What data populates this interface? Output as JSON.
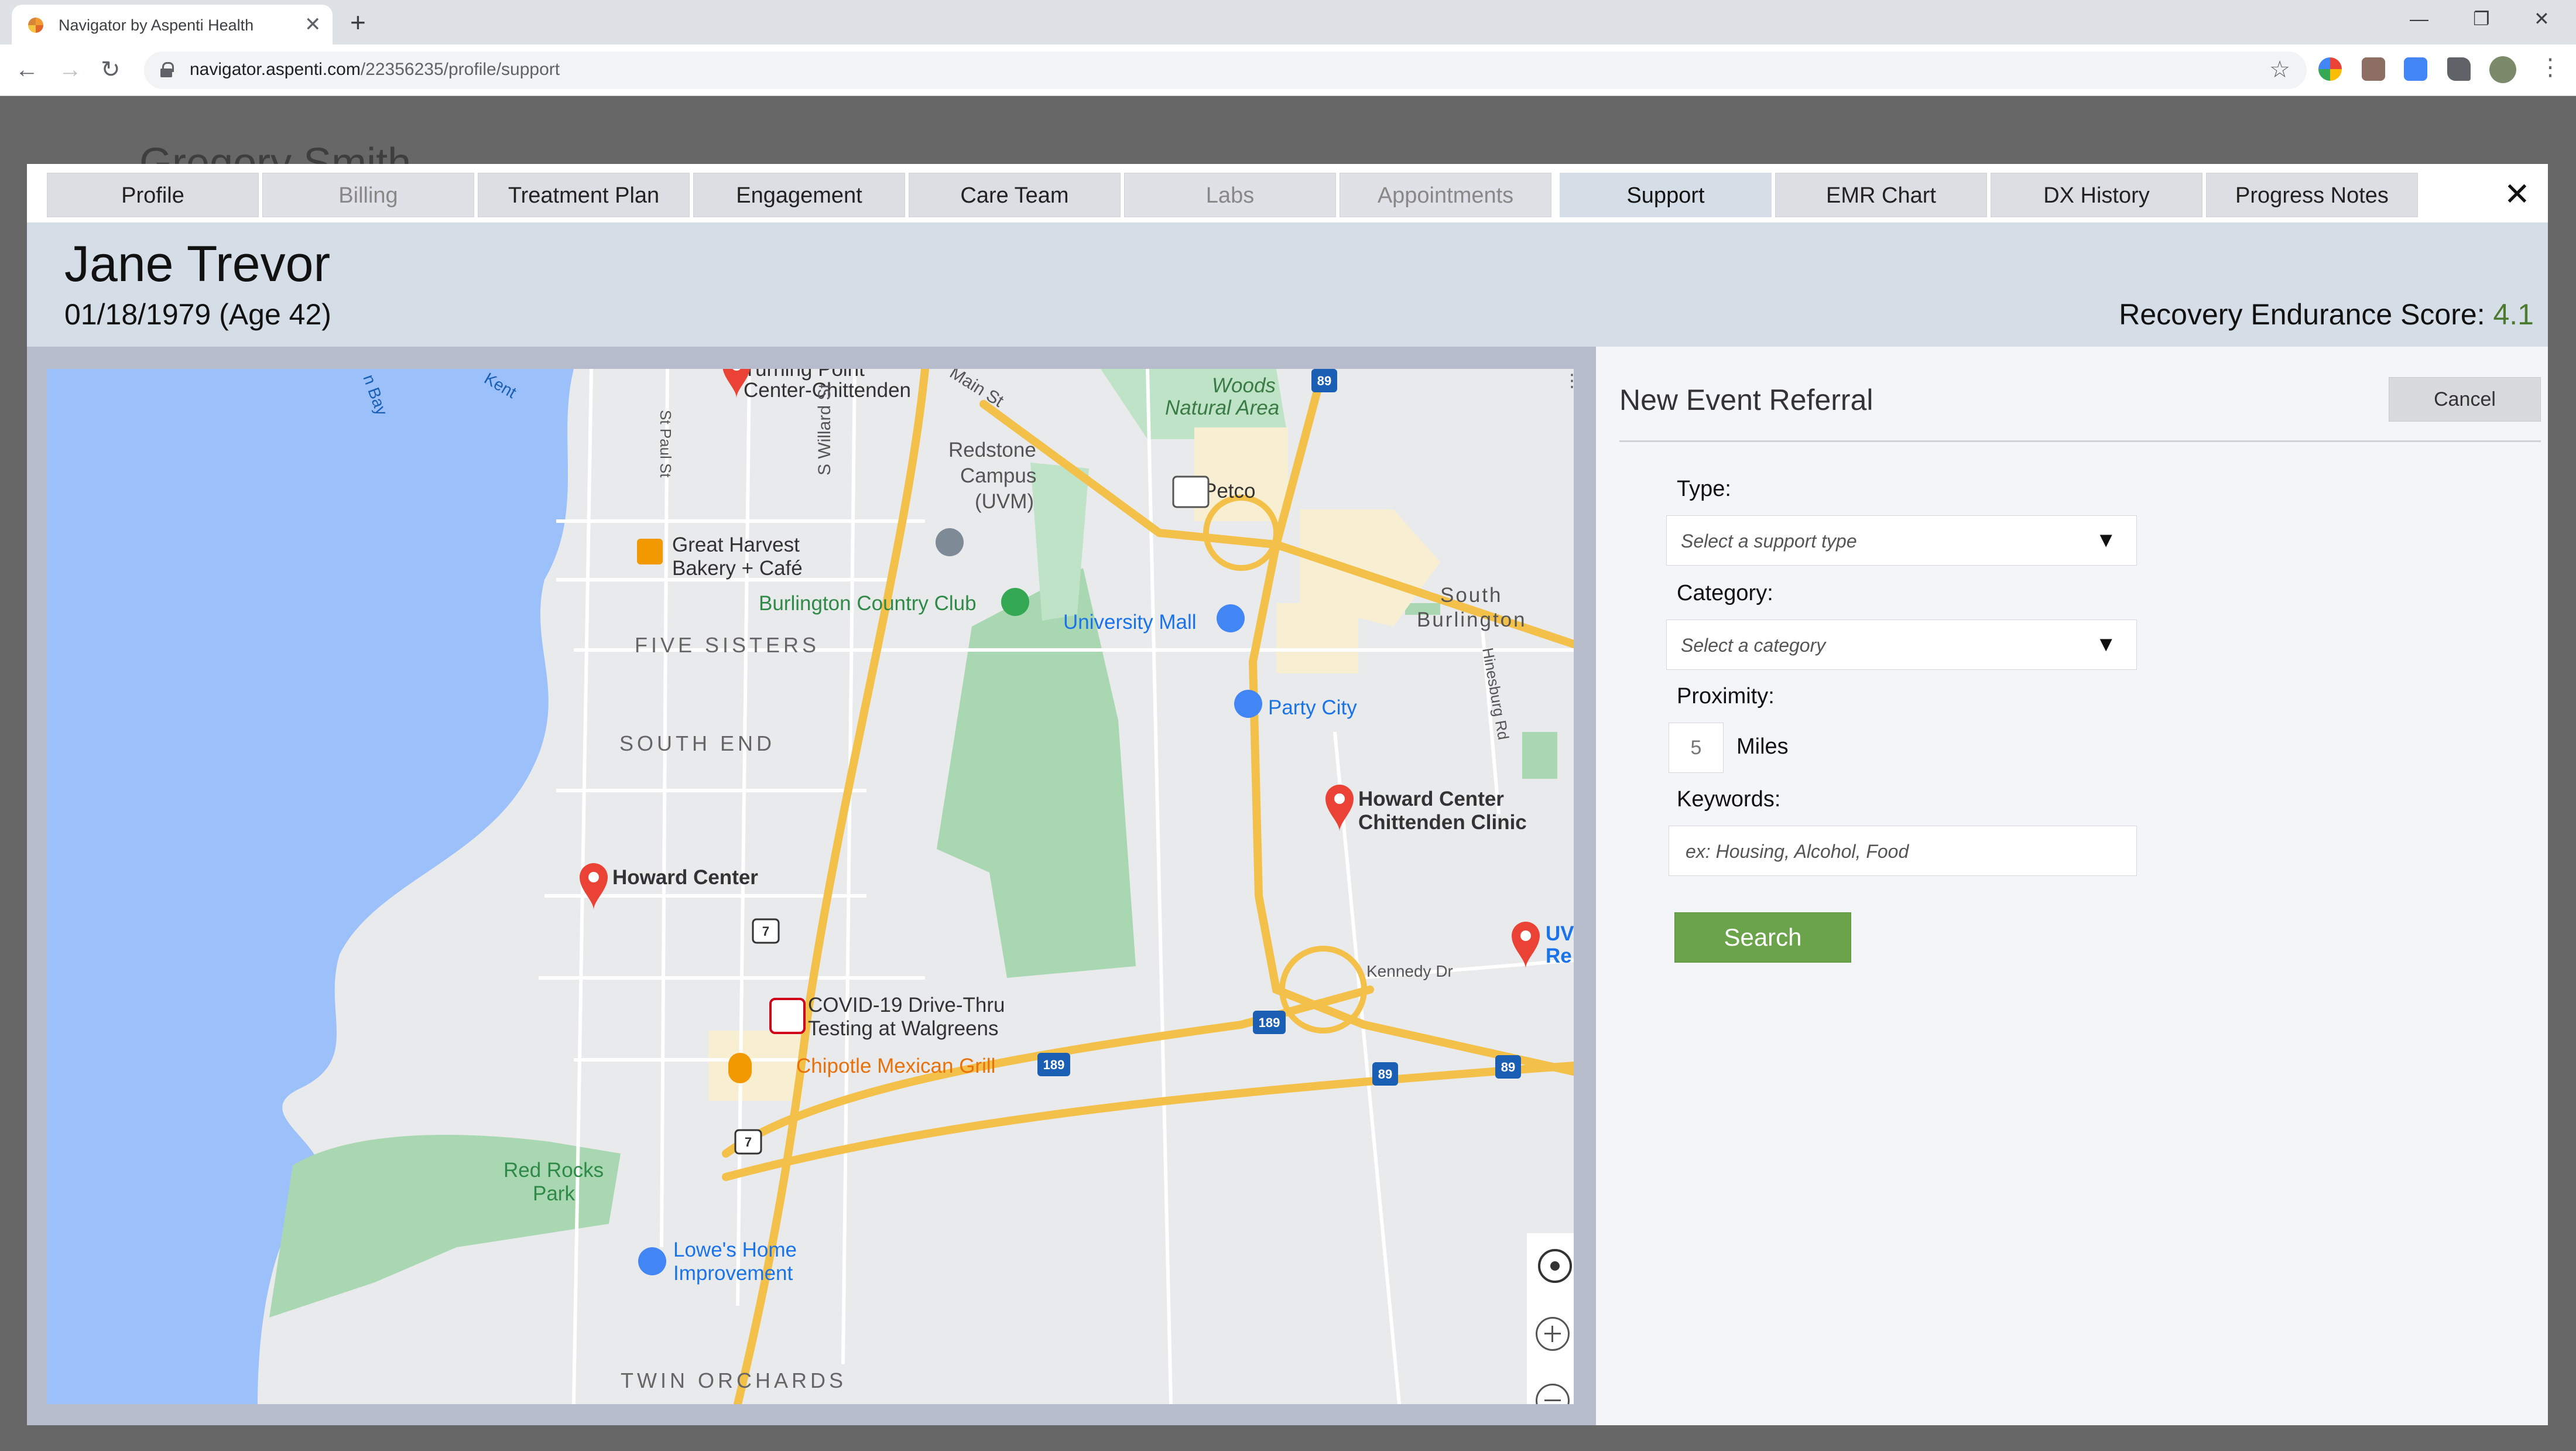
{
  "browser": {
    "tab_title": "Navigator by Aspenti Health",
    "url_host": "navigator.aspenti.com",
    "url_path": "/22356235/profile/support"
  },
  "background": {
    "name_partial": "Gregory Smith"
  },
  "modal": {
    "tabs": [
      {
        "label": "Profile",
        "state": "enabled"
      },
      {
        "label": "Billing",
        "state": "disabled"
      },
      {
        "label": "Treatment Plan",
        "state": "enabled"
      },
      {
        "label": "Engagement",
        "state": "enabled"
      },
      {
        "label": "Care Team",
        "state": "enabled"
      },
      {
        "label": "Labs",
        "state": "disabled"
      },
      {
        "label": "Appointments",
        "state": "disabled"
      },
      {
        "label": "Support",
        "state": "active"
      },
      {
        "label": "EMR Chart",
        "state": "enabled"
      },
      {
        "label": "DX History",
        "state": "enabled"
      },
      {
        "label": "Progress Notes",
        "state": "enabled"
      }
    ],
    "close": "✕"
  },
  "patient": {
    "name": "Jane Trevor",
    "dob": "01/18/1979 (Age 42)",
    "score_label": "Recovery Endurance Score: ",
    "score_value": "4.1"
  },
  "map": {
    "labels": {
      "turning_point_1": "Turning Point",
      "turning_point_2": "Center-Chittenden",
      "woods_1": "Woods",
      "woods_2": "Natural Area",
      "main_st": "Main St",
      "redstone_1": "Redstone",
      "redstone_2": "Campus",
      "redstone_3": "(UVM)",
      "petco": "Petco",
      "great_harvest_1": "Great Harvest",
      "great_harvest_2": "Bakery + Café",
      "south_burlington_1": "South",
      "south_burlington_2": "Burlington",
      "country_club": "Burlington Country Club",
      "university_mall": "University Mall",
      "five_sisters": "FIVE SISTERS",
      "party_city": "Party City",
      "south_end": "SOUTH END",
      "howard_chittenden_1": "Howard Center",
      "howard_chittenden_2": "Chittenden Clinic",
      "howard_center": "Howard Center",
      "uvm_partial_1": "UV",
      "uvm_partial_2": "Re",
      "kennedy_dr": "Kennedy Dr",
      "covid_1": "COVID-19 Drive-Thru",
      "covid_2": "Testing at Walgreens",
      "chipotle": "Chipotle Mexican Grill",
      "red_rocks_1": "Red Rocks",
      "red_rocks_2": "Park",
      "lowes_1": "Lowe's Home",
      "lowes_2": "Improvement",
      "twin_orchards": "TWIN ORCHARDS",
      "st_paul": "St Paul St",
      "willard": "S Willard St",
      "hinesburg": "Hinesburg Rd",
      "kent": "Kent",
      "bay": "n Bay",
      "route_7": "7",
      "route_89": "89",
      "route_189": "189"
    },
    "colors": {
      "water": "#9cc0f9",
      "land": "#e9eaeb",
      "park": "#a8d7b1",
      "highway": "#f3c04a",
      "pin": "#ea4335"
    }
  },
  "referral": {
    "title": "New Event Referral",
    "cancel": "Cancel",
    "type_label": "Type:",
    "type_placeholder": "Select a support type",
    "category_label": "Category:",
    "category_placeholder": "Select a category",
    "proximity_label": "Proximity:",
    "proximity_value": "5",
    "proximity_unit": "Miles",
    "keywords_label": "Keywords:",
    "keywords_placeholder": "ex: Housing, Alcohol, Food",
    "search": "Search"
  }
}
